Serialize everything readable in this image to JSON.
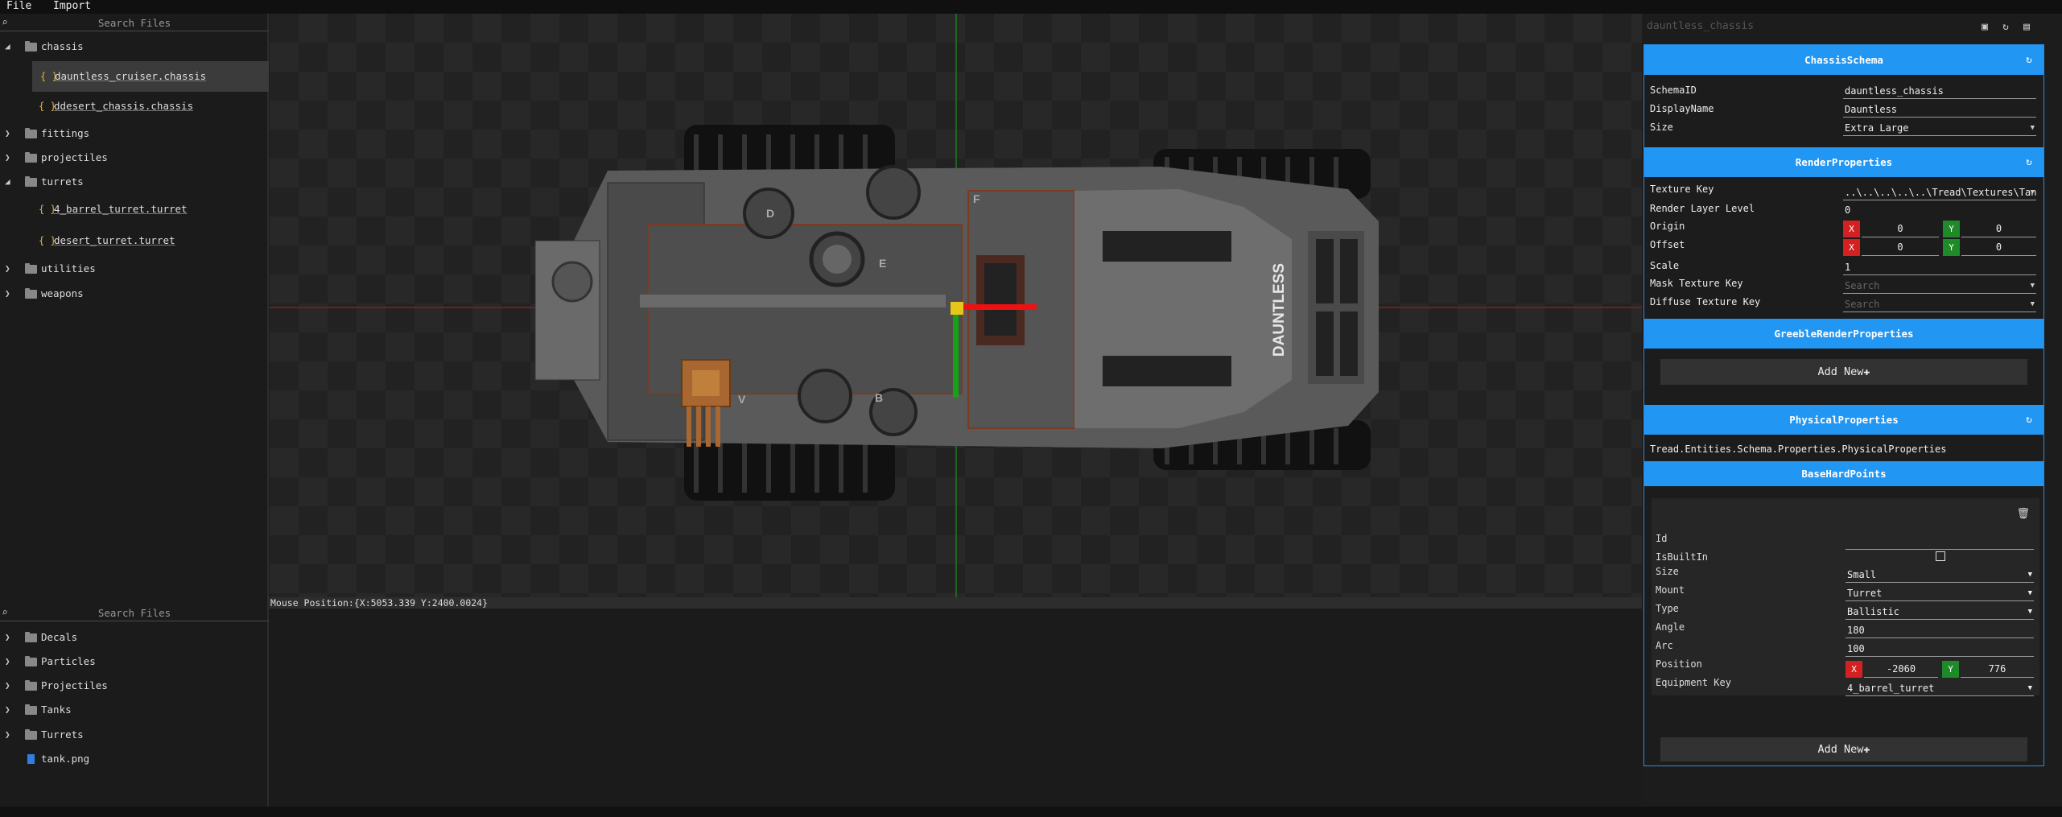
{
  "menu": {
    "file": "File",
    "import": "Import"
  },
  "top_browser": {
    "search_placeholder": "Search Files",
    "chassis": "chassis",
    "file1": "dauntless_cruiser.chassis",
    "file2": "ddesert_chassis.chassis",
    "fittings": "fittings",
    "projectiles": "projectiles",
    "turrets": "turrets",
    "file3": "4_barrel_turret.turret",
    "file4": "desert_turret.turret",
    "utilities": "utilities",
    "weapons": "weapons"
  },
  "bottom_browser": {
    "search_placeholder": "Search Files",
    "decals": "Decals",
    "particles": "Particles",
    "projectiles": "Projectiles",
    "tanks": "Tanks",
    "turrets": "Turrets",
    "tank_png": "tank.png"
  },
  "status": {
    "mouse_position": "Mouse Position:{X:5053.339 Y:2400.0024}"
  },
  "tank": {
    "name_text": "DAUNTLESS",
    "letters": [
      "D",
      "E",
      "F",
      "V",
      "B"
    ]
  },
  "inspector": {
    "title": "dauntless_chassis",
    "chassis_schema": {
      "header": "ChassisSchema",
      "schema_id_label": "SchemaID",
      "schema_id": "dauntless_chassis",
      "display_name_label": "DisplayName",
      "display_name": "Dauntless",
      "size_label": "Size",
      "size": "Extra Large"
    },
    "render": {
      "header": "RenderProperties",
      "texture_key_label": "Texture Key",
      "texture_key": "..\\..\\..\\..\\..\\Tread\\Textures\\Tank",
      "layer_label": "Render Layer Level",
      "layer": "0",
      "origin_label": "Origin",
      "origin_x": "0",
      "origin_y": "0",
      "offset_label": "Offset",
      "offset_x": "0",
      "offset_y": "0",
      "scale_label": "Scale",
      "scale": "1",
      "mask_label": "Mask Texture Key",
      "mask_placeholder": "Search",
      "diffuse_label": "Diffuse Texture Key",
      "diffuse_placeholder": "Search"
    },
    "greeble": {
      "header": "GreebleRenderProperties",
      "add_new": "Add New"
    },
    "physical": {
      "header": "PhysicalProperties",
      "type_text": "Tread.Entities.Schema.Properties.PhysicalProperties"
    },
    "hardpoints": {
      "header": "BaseHardPoints",
      "id_label": "Id",
      "id": "",
      "builtin_label": "IsBuiltIn",
      "size_label": "Size",
      "size": "Small",
      "mount_label": "Mount",
      "mount": "Turret",
      "type_label": "Type",
      "type": "Ballistic",
      "angle_label": "Angle",
      "angle": "180",
      "arc_label": "Arc",
      "arc": "100",
      "position_label": "Position",
      "pos_x": "-2060",
      "pos_y": "776",
      "equip_label": "Equipment Key",
      "equip": "4_barrel_turret",
      "add_new": "Add New"
    },
    "axis_x": "X",
    "axis_y": "Y"
  }
}
